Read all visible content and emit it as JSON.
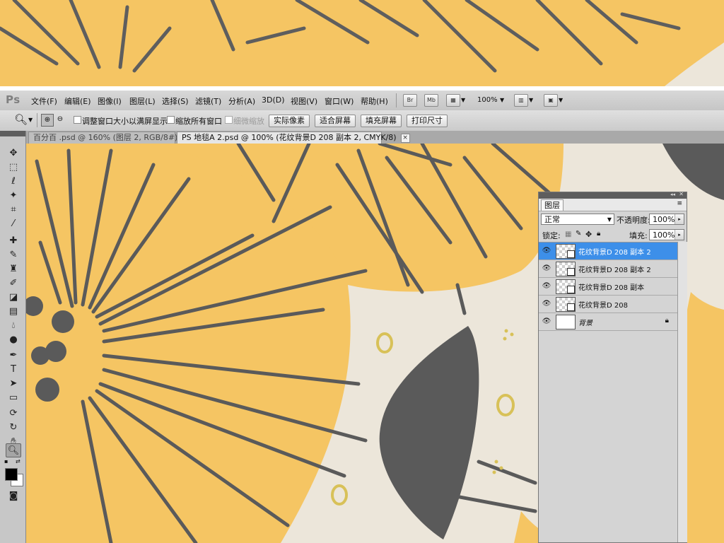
{
  "app": {
    "logo": "Ps"
  },
  "menubar": {
    "items": [
      "文件(F)",
      "编辑(E)",
      "图像(I)",
      "图层(L)",
      "选择(S)",
      "滤镜(T)",
      "分析(A)",
      "3D(D)",
      "视图(V)",
      "窗口(W)",
      "帮助(H)"
    ],
    "bridge_label": "Br",
    "minibridge_label": "Mb",
    "zoom_level": "100%"
  },
  "options": {
    "resize_windows_label": "调整窗口大小以满屏显示",
    "zoom_all_windows_label": "缩放所有窗口",
    "scrubby_zoom_label": "细微缩放",
    "actual_pixels_label": "实际像素",
    "fit_screen_label": "适合屏幕",
    "fill_screen_label": "填充屏幕",
    "print_size_label": "打印尺寸"
  },
  "tabs": [
    {
      "label": "百分百 .psd @ 160% (图层 2, RGB/8#) *",
      "active": false
    },
    {
      "label": "PS 地毯A 2.psd @ 100% (花纹背景D 208 副本 2, CMYK/8)",
      "active": true
    }
  ],
  "tab_close_glyph": "×",
  "layers_panel": {
    "tab_label": "图层",
    "blend_mode": "正常",
    "opacity_label": "不透明度:",
    "opacity_value": "100%",
    "lock_label": "锁定:",
    "fill_label": "填充:",
    "fill_value": "100%",
    "layers": [
      {
        "name": "花纹背景D 208 副本 2",
        "selected": true
      },
      {
        "name": "花纹背景D 208 副本 2",
        "selected": false
      },
      {
        "name": "花纹背景D 208 副本",
        "selected": false
      },
      {
        "name": "花纹背景D 208",
        "selected": false
      },
      {
        "name": "背景",
        "selected": false
      }
    ]
  },
  "colors": {
    "artwork_yellow": "#f5c563",
    "artwork_gray": "#5a5a5a",
    "artwork_cream": "#ece6da",
    "selection_blue": "#3d8fe9"
  }
}
